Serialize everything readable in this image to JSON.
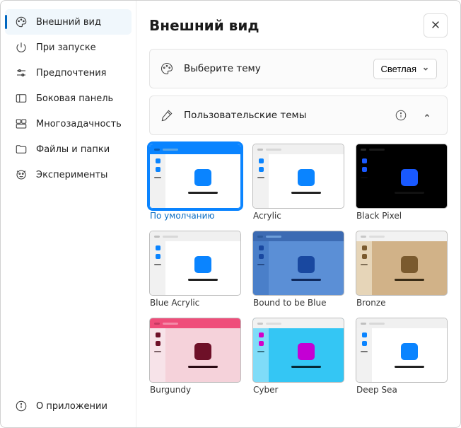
{
  "sidebar": {
    "items": [
      {
        "label": "Внешний вид"
      },
      {
        "label": "При запуске"
      },
      {
        "label": "Предпочтения"
      },
      {
        "label": "Боковая панель"
      },
      {
        "label": "Многозадачность"
      },
      {
        "label": "Файлы и папки"
      },
      {
        "label": "Эксперименты"
      }
    ],
    "footer": {
      "label": "О приложении"
    }
  },
  "header": {
    "title": "Внешний вид"
  },
  "select_theme": {
    "label": "Выберите тему",
    "value": "Светлая"
  },
  "custom_themes": {
    "label": "Пользовательские темы"
  },
  "themes": [
    {
      "label": "По умолчанию",
      "selected": true,
      "colors": {
        "bg": "#ffffff",
        "titlebar": "#0a84ff",
        "side": "#f1f1f1",
        "accent": "#0a84ff",
        "sideAccent": "#0a84ff",
        "line": "#222222",
        "tbBar1": "#0a5bb3",
        "tbBar2": "#5ba6e6"
      }
    },
    {
      "label": "Acrylic",
      "selected": false,
      "colors": {
        "bg": "#ffffff",
        "titlebar": "#f0f0f0",
        "side": "#f1f1f1",
        "accent": "#0a84ff",
        "sideAccent": "#0a84ff",
        "line": "#222222",
        "tbBar1": "#bfbfbf",
        "tbBar2": "#d8d8d8"
      }
    },
    {
      "label": "Black Pixel",
      "selected": false,
      "colors": {
        "bg": "#000000",
        "titlebar": "#000000",
        "side": "#000000",
        "accent": "#1959ff",
        "sideAccent": "#1959ff",
        "line": "#111111",
        "tbBar1": "#2a2a2a",
        "tbBar2": "#1a1a1a"
      }
    },
    {
      "label": "Blue Acrylic",
      "selected": false,
      "colors": {
        "bg": "#ffffff",
        "titlebar": "#f0f0f0",
        "side": "#f1f1f1",
        "accent": "#0a84ff",
        "sideAccent": "#0a84ff",
        "line": "#222222",
        "tbBar1": "#bfbfbf",
        "tbBar2": "#d8d8d8"
      }
    },
    {
      "label": "Bound to be Blue",
      "selected": false,
      "colors": {
        "bg": "#5b8fd6",
        "titlebar": "#3c6bb3",
        "side": "#4a7fc9",
        "accent": "#1948a0",
        "sideAccent": "#1948a0",
        "line": "#0f2a5e",
        "tbBar1": "#2b5a9c",
        "tbBar2": "#6d9ed9"
      }
    },
    {
      "label": "Bronze",
      "selected": false,
      "colors": {
        "bg": "#d1b288",
        "titlebar": "#f2f2f2",
        "side": "#e6d5b8",
        "accent": "#7a5a2e",
        "sideAccent": "#7a5a2e",
        "line": "#3a2c16",
        "tbBar1": "#c7c7c7",
        "tbBar2": "#dddddd"
      }
    },
    {
      "label": "Burgundy",
      "selected": false,
      "colors": {
        "bg": "#f5d2da",
        "titlebar": "#ef4d7a",
        "side": "#f7e3e9",
        "accent": "#6e1028",
        "sideAccent": "#6e1028",
        "line": "#2a0b13",
        "tbBar1": "#c63a63",
        "tbBar2": "#f48aa8"
      }
    },
    {
      "label": "Cyber",
      "selected": false,
      "colors": {
        "bg": "#34c6f4",
        "titlebar": "#f2f2f2",
        "side": "#7fdcf8",
        "accent": "#c400d4",
        "sideAccent": "#d400c8",
        "line": "#052a36",
        "tbBar1": "#c7c7c7",
        "tbBar2": "#dddddd"
      }
    },
    {
      "label": "Deep Sea",
      "selected": false,
      "colors": {
        "bg": "#ffffff",
        "titlebar": "#f0f0f0",
        "side": "#f1f1f1",
        "accent": "#0a84ff",
        "sideAccent": "#0a84ff",
        "line": "#222222",
        "tbBar1": "#bfbfbf",
        "tbBar2": "#d8d8d8"
      }
    }
  ]
}
